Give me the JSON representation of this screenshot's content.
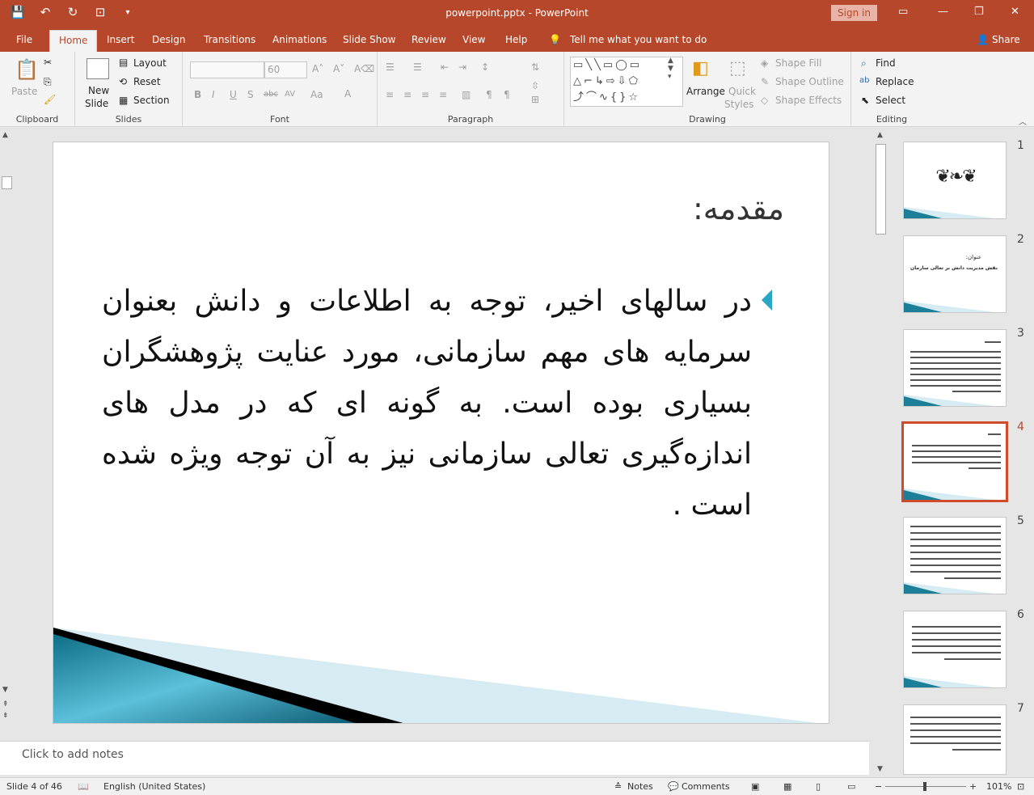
{
  "window": {
    "title": "powerpoint.pptx  -  PowerPoint",
    "signin": "Sign in"
  },
  "tabs": [
    "File",
    "Home",
    "Insert",
    "Design",
    "Transitions",
    "Animations",
    "Slide Show",
    "Review",
    "View",
    "Help"
  ],
  "tell_me": "Tell me what you want to do",
  "share": "Share",
  "ribbon": {
    "clipboard": {
      "label": "Clipboard",
      "paste": "Paste"
    },
    "slides": {
      "label": "Slides",
      "new_slide_1": "New",
      "new_slide_2": "Slide",
      "layout": "Layout",
      "reset": "Reset",
      "section": "Section"
    },
    "font": {
      "label": "Font",
      "size": "60"
    },
    "paragraph": {
      "label": "Paragraph"
    },
    "drawing": {
      "label": "Drawing",
      "arrange": "Arrange",
      "quick_styles_1": "Quick",
      "quick_styles_2": "Styles",
      "shape_fill": "Shape Fill",
      "shape_outline": "Shape Outline",
      "shape_effects": "Shape Effects"
    },
    "editing": {
      "label": "Editing",
      "find": "Find",
      "replace": "Replace",
      "select": "Select"
    }
  },
  "slide": {
    "title": "مقدمه:",
    "body": "در سالهای اخیر، توجه به اطلاعات و دانش بعنوان سرمایه های مهم سازمانی، مورد عنایت پژوهشگران بسیاری بوده است. به گونه ای که در مدل های اندازه‌گیری تعالی سازمانی نیز به آن توجه ویژه شده است ."
  },
  "thumbnails": [
    {
      "num": "1"
    },
    {
      "num": "2",
      "title": "عنوان:",
      "subtitle": "نقش مدیریت دانش بر تعالی سازمان"
    },
    {
      "num": "3"
    },
    {
      "num": "4",
      "selected": true
    },
    {
      "num": "5"
    },
    {
      "num": "6"
    },
    {
      "num": "7"
    }
  ],
  "notes": "Click to add notes",
  "status": {
    "slide": "Slide 4 of 46",
    "language": "English (United States)",
    "notes": "Notes",
    "comments": "Comments",
    "zoom": "101%"
  },
  "colors": {
    "accent": "#b7472a",
    "bullet": "#2ba6c4"
  }
}
